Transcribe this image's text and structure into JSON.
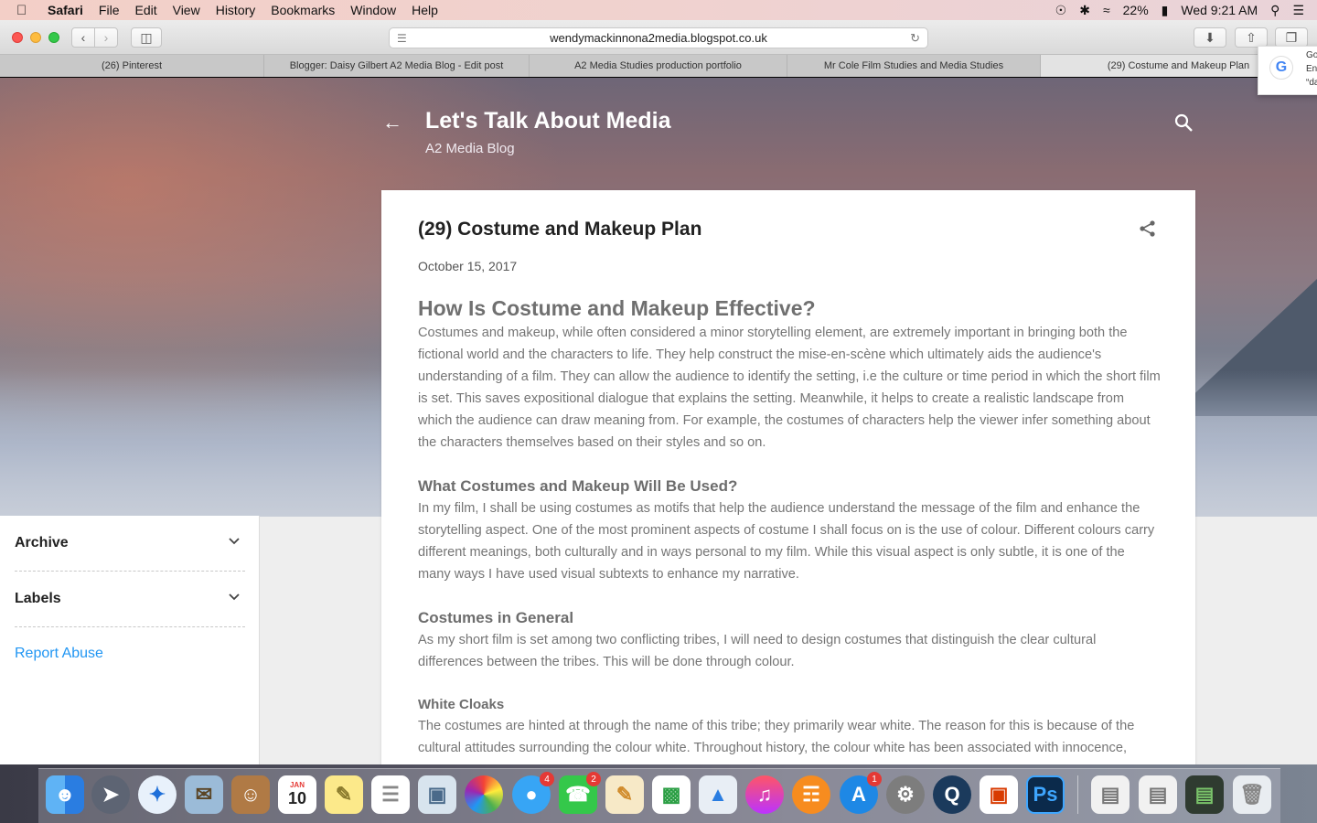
{
  "menubar": {
    "app": "Safari",
    "items": [
      "File",
      "Edit",
      "View",
      "History",
      "Bookmarks",
      "Window",
      "Help"
    ],
    "battery": "22%",
    "clock": "Wed 9:21 AM"
  },
  "toolbar": {
    "url": "wendymackinnona2media.blogspot.co.uk"
  },
  "tabs": [
    "(26) Pinterest",
    "Blogger: Daisy Gilbert A2 Media Blog - Edit post",
    "A2 Media Studies production portfolio",
    "Mr Cole Film Studies and Media Studies",
    "(29) Costume and Makeup Plan"
  ],
  "google_popup": {
    "logo": "G",
    "line1": "Go",
    "line2": "En",
    "line3": "“da"
  },
  "blog": {
    "title": "Let's Talk About Media",
    "subtitle": "A2 Media Blog"
  },
  "sidebar": {
    "archive": "Archive",
    "labels": "Labels",
    "report": "Report Abuse"
  },
  "post": {
    "title": "(29) Costume and Makeup Plan",
    "date": "October 15, 2017",
    "h1": "How Is Costume and Makeup Effective?",
    "p1": "Costumes and makeup, while often considered a minor storytelling element, are extremely important in bringing both the fictional world and the characters to life. They help construct the mise-en-scène which ultimately aids the audience's understanding of a film. They can allow the audience to identify the setting, i.e the culture or time period in which the short film is set. This saves expositional dialogue that explains the setting. Meanwhile, it helps to create a realistic landscape from which the audience can draw meaning from. For example, the costumes of characters help the viewer infer something about the characters themselves based on their styles and so on.",
    "h2": "What Costumes and Makeup Will Be Used?",
    "p2": "In my film, I shall be using costumes as motifs that help the audience understand the message of the film and enhance the storytelling aspect. One of the most prominent aspects of costume I shall focus on is the use of colour. Different colours carry different meanings, both culturally and in ways personal to my film. While this visual aspect is only subtle, it is one of the many ways I have used visual subtexts to enhance my narrative.",
    "h3": "Costumes in General",
    "p3": "As my short film is set among two conflicting tribes, I will need to design costumes that distinguish the clear cultural differences between the tribes. This will be done through colour.",
    "h4": "White Cloaks",
    "p4": "The costumes are hinted at through the name of this tribe; they primarily wear white. The reason for this is because of the cultural attitudes surrounding the colour white. Throughout history, the colour white has been associated with innocence,"
  },
  "dock": {
    "calendar_month": "JAN",
    "calendar_day": "10",
    "messages_badge": "4",
    "facetime_badge": "2",
    "appstore_badge": "1",
    "ps_label": "Ps"
  },
  "colors": {
    "link": "#2196f3",
    "close": "#fc5753",
    "minimize": "#fdbc40",
    "zoom": "#34c84a"
  }
}
